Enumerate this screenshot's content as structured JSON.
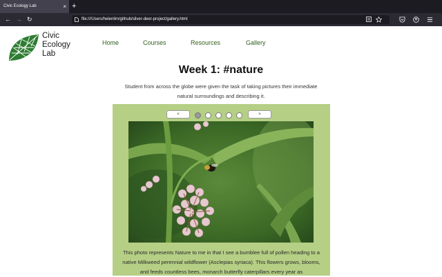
{
  "browser": {
    "tab_title": "Civic Ecology Lab",
    "tab_close": "×",
    "new_tab": "+",
    "back": "←",
    "forward": "→",
    "reload": "↻",
    "url": "file:///Users/helenlim/github/silver-deer-project/gallery.html"
  },
  "site": {
    "logo_lines": [
      "Civic",
      "Ecology",
      "Lab"
    ],
    "nav": [
      "Home",
      "Courses",
      "Resources",
      "Gallery"
    ]
  },
  "main": {
    "title": "Week 1: #nature",
    "intro": "Student from across the globe were given the task of taking pictures their immediate natural surroundings and describing it."
  },
  "carousel": {
    "prev_label": "<",
    "next_label": ">",
    "dot_count": 5,
    "active_dot": 1,
    "caption": "This photo represents Nature to me in that I see a bumblee full of pollen heading to a native Milkweed perennial wildflower (Asclepias syriaca). This flowers grows, blooms, and feeds countless bees, monarch butterfly caterpillars every year as"
  },
  "colors": {
    "gallery_bg": "#b5cf85",
    "nav_link": "#2e5e1a",
    "logo_green": "#2e7d32"
  }
}
